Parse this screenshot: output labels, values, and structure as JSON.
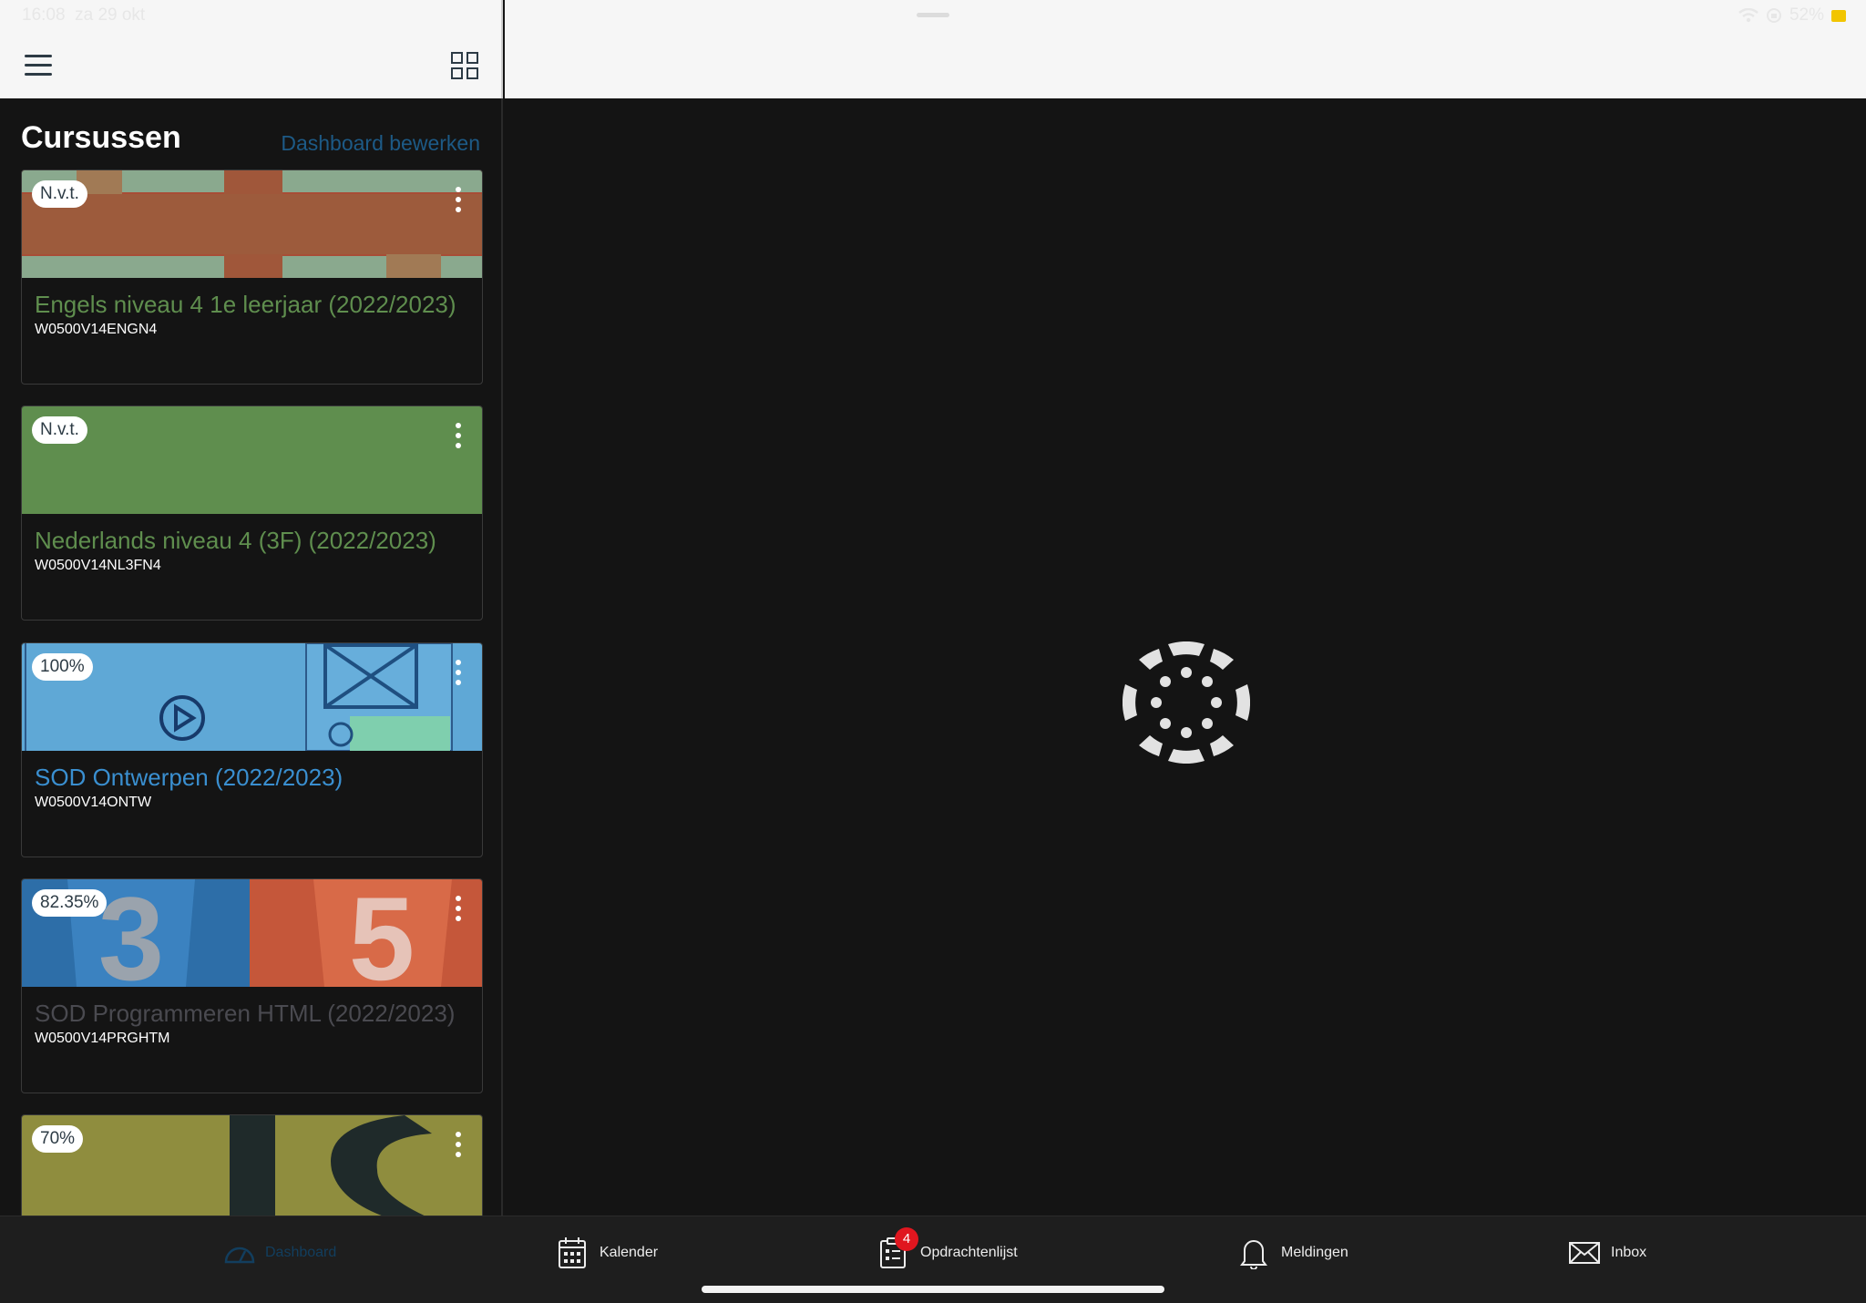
{
  "status_bar": {
    "time": "16:08",
    "date": "za 29 okt",
    "battery": "52%"
  },
  "header": {
    "menu_icon": "hamburger-icon",
    "grid_icon": "grid-view-icon"
  },
  "panel": {
    "title": "Cursussen",
    "edit_link": "Dashboard bewerken"
  },
  "courses": [
    {
      "badge": "N.v.t.",
      "title": "Engels niveau 4 1e leerjaar (2022/2023)",
      "code": "W0500V14ENGN4",
      "color": "#5f8e4e"
    },
    {
      "badge": "N.v.t.",
      "title": "Nederlands niveau 4 (3F) (2022/2023)",
      "code": "W0500V14NL3FN4",
      "color": "#5f8e4e"
    },
    {
      "badge": "100%",
      "title": "SOD Ontwerpen (2022/2023)",
      "code": "W0500V14ONTW",
      "color": "#3a8fd0"
    },
    {
      "badge": "82.35%",
      "title": "SOD Programmeren HTML (2022/2023)",
      "code": "W0500V14PRGHTM",
      "color": "#4a4a50"
    },
    {
      "badge": "70%",
      "title": "",
      "code": "",
      "color": "#8f8d3e"
    }
  ],
  "tabs": [
    {
      "label": "Dashboard",
      "icon": "dashboard-icon"
    },
    {
      "label": "Kalender",
      "icon": "calendar-icon"
    },
    {
      "label": "Opdrachtenlijst",
      "icon": "todo-list-icon",
      "badge": "4"
    },
    {
      "label": "Meldingen",
      "icon": "bell-icon"
    },
    {
      "label": "Inbox",
      "icon": "mail-icon"
    }
  ],
  "colors": {
    "accent": "#123e5e",
    "badge_red": "#e0161f",
    "header_bg": "#f6f6f6",
    "body_bg": "#141414"
  }
}
